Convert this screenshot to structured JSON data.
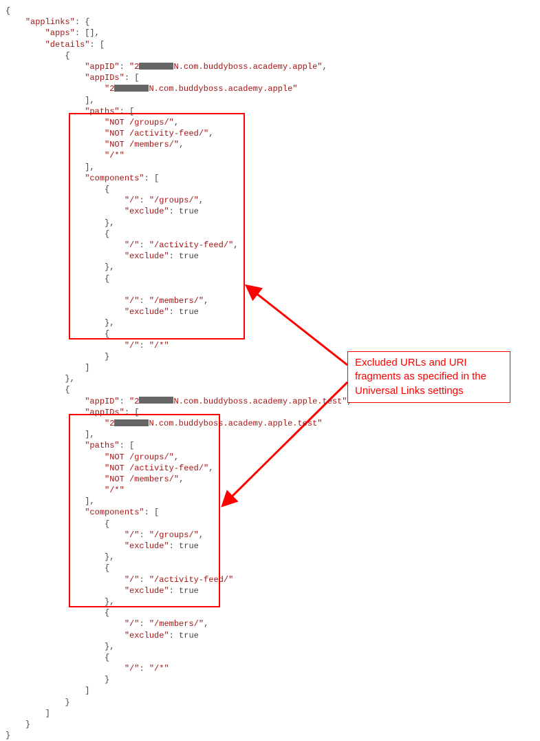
{
  "callout": {
    "text": "Excluded URLs and URI fragments as specified in the Universal Links settings"
  },
  "code": {
    "open_brace": "{",
    "applinks_key": "\"applinks\"",
    "colon_open": ": {",
    "apps_key": "\"apps\"",
    "apps_val": ": [],",
    "details_key": "\"details\"",
    "details_open": ": [",
    "obj_open": "{",
    "appID_key": "\"appID\"",
    "appID_colon": ": ",
    "appID1_prefix": "\"2",
    "appID1_suffix": "N.com.buddyboss.academy.apple\"",
    "comma": ",",
    "appIDs_key": "\"appIDs\"",
    "appIDs_open": ": [",
    "close_bracket_comma": "],",
    "paths_key": "\"paths\"",
    "paths_open": ": [",
    "path1": "\"NOT /groups/\"",
    "path2": "\"NOT /activity-feed/\"",
    "path3": "\"NOT /members/\"",
    "path4": "\"/*\"",
    "components_key": "\"components\"",
    "components_open": ": [",
    "slash_key": "\"/\"",
    "colon_sp": ": ",
    "groups_val": "\"/groups/\"",
    "exclude_key": "\"exclude\"",
    "true_val": ": true",
    "close_brace_comma": "},",
    "activity_val": "\"/activity-feed/\"",
    "members_val": "\"/members/\"",
    "star_val": "\"/*\"",
    "close_brace": "}",
    "close_bracket": "]",
    "appID2_suffix": "N.com.buddyboss.academy.apple.test\"",
    "activity_val_trunc": "\"/activity-feed/\""
  }
}
